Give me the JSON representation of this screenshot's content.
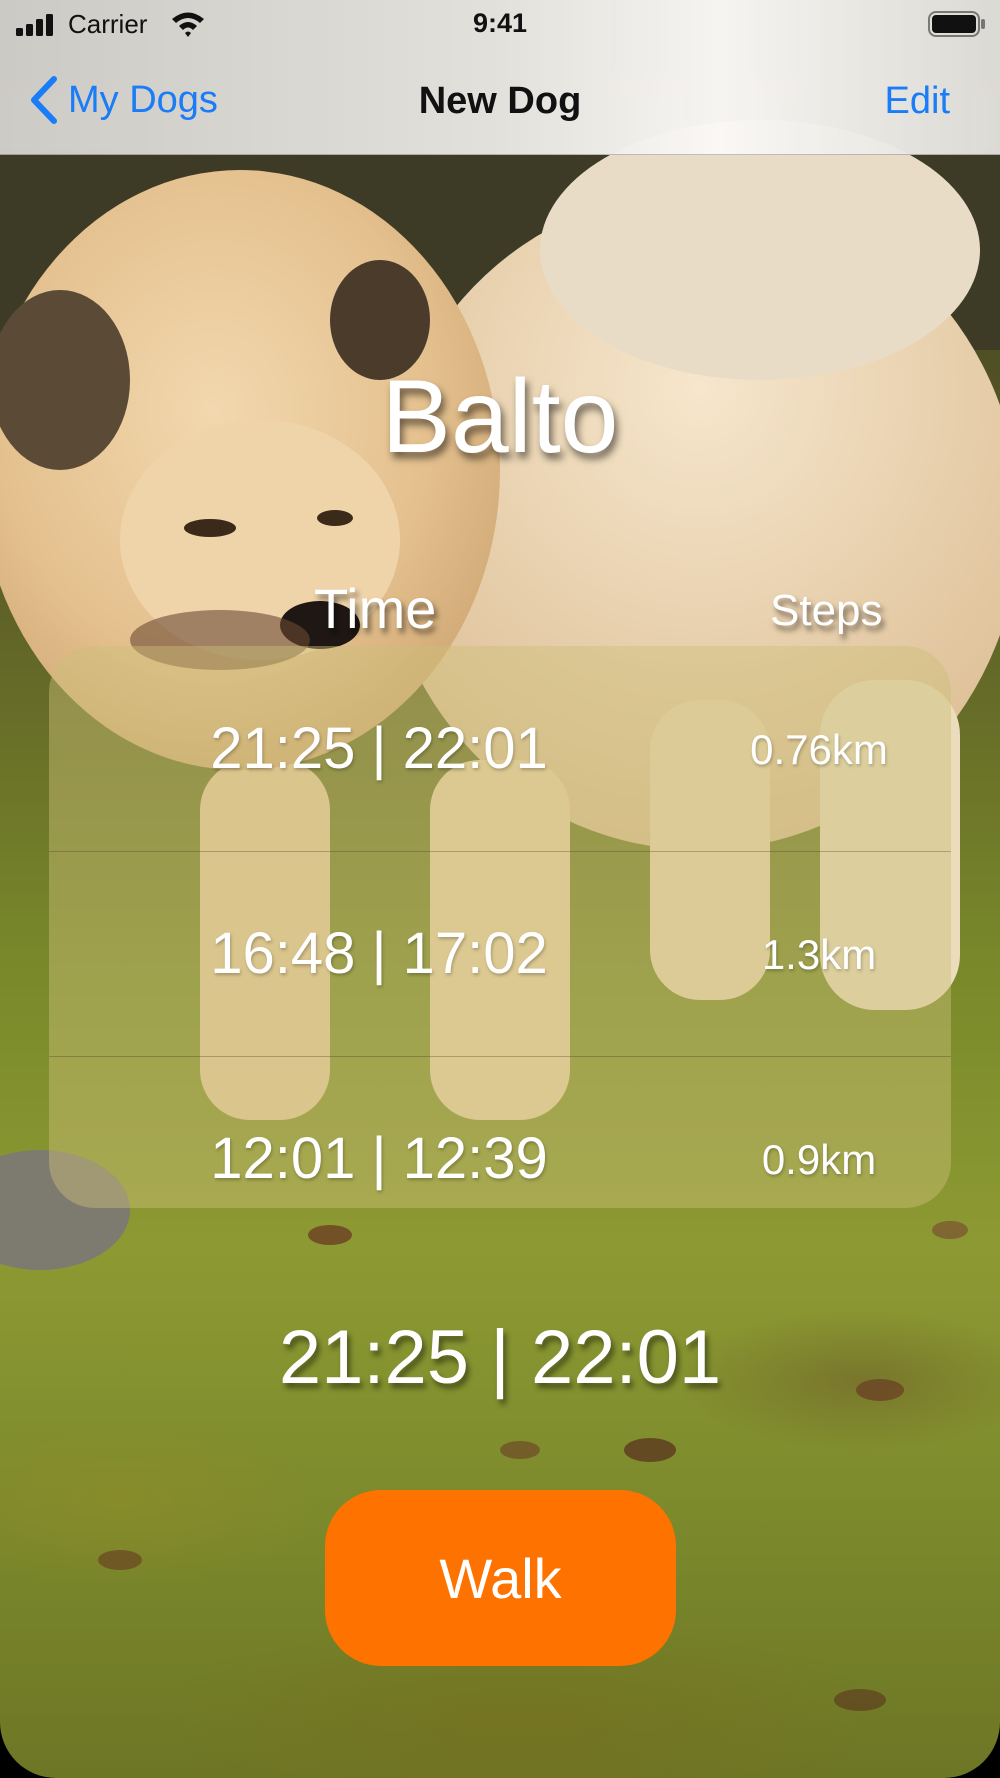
{
  "status_bar": {
    "carrier": "Carrier",
    "time": "9:41"
  },
  "nav": {
    "back_label": "My Dogs",
    "title": "New Dog",
    "edit_label": "Edit",
    "accent_color": "#1a7cf7"
  },
  "dog": {
    "name": "Balto"
  },
  "table": {
    "headers": {
      "time": "Time",
      "steps": "Steps"
    },
    "rows": [
      {
        "time": "21:25 | 22:01",
        "distance": "0.76km"
      },
      {
        "time": "16:48 | 17:02",
        "distance": "1.3km"
      },
      {
        "time": "12:01 | 12:39",
        "distance": "0.9km"
      }
    ]
  },
  "current_walk": "21:25 | 22:01",
  "walk_button": {
    "label": "Walk",
    "color": "#fe7300"
  },
  "icons": [
    "signal-icon",
    "wifi-icon",
    "battery-icon",
    "chevron-left-icon"
  ]
}
